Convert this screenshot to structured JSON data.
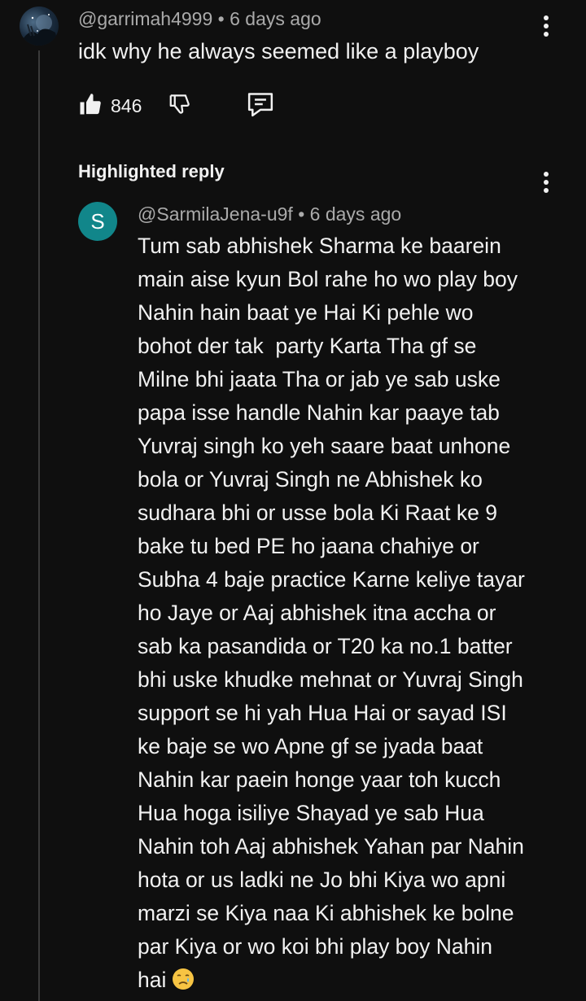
{
  "comment": {
    "handle": "@garrimah4999",
    "separator": "•",
    "age": "6 days ago",
    "text": "idk why he always seemed like a playboy",
    "like_count": "846"
  },
  "highlighted_reply_label": "Highlighted reply",
  "reply": {
    "avatar_letter": "S",
    "avatar_color": "#11868a",
    "handle": "@SarmilaJena-u9f",
    "separator": "•",
    "age": "6 days ago",
    "lines": [
      "Tum sab abhishek Sharma ke baarein",
      "main aise kyun Bol rahe ho wo play boy",
      "Nahin hain baat ye Hai Ki pehle wo",
      "bohot der tak  party Karta Tha gf se",
      "Milne bhi jaata Tha or jab ye sab uske",
      "papa isse handle Nahin kar paaye tab",
      "Yuvraj singh ko yeh saare baat unhone",
      "bola or Yuvraj Singh ne Abhishek ko",
      "sudhara bhi or usse bola Ki Raat ke 9",
      "bake tu bed PE ho jaana chahiye or",
      "Subha 4 baje practice Karne keliye tayar",
      "ho Jaye or Aaj abhishek itna accha or",
      "sab ka pasandida or T20 ka no.1 batter",
      "bhi uske khudke mehnat or Yuvraj Singh",
      "support se hi yah Hua Hai or sayad ISI",
      "ke baje se wo Apne gf se jyada baat",
      "Nahin kar paein honge yaar toh kucch",
      "Hua hoga isiliye Shayad ye sab Hua",
      "Nahin toh Aaj abhishek Yahan par Nahin",
      "hota or us ladki ne Jo bhi Kiya wo apni",
      "marzi se Kiya naa Ki abhishek ke bolne",
      "par Kiya or wo koi bhi play boy Nahin",
      "hai"
    ],
    "trailing_emoji": "crying-face-emoji"
  },
  "icons": {
    "like": "thumbs-up-icon",
    "dislike": "thumbs-down-icon",
    "reply": "comment-icon",
    "more": "more-vert-icon"
  },
  "colors": {
    "background": "#0f0f0f",
    "primary_text": "#f1f1f1",
    "secondary_text": "#aaaaaa",
    "thread_line": "#3a3a3a"
  }
}
